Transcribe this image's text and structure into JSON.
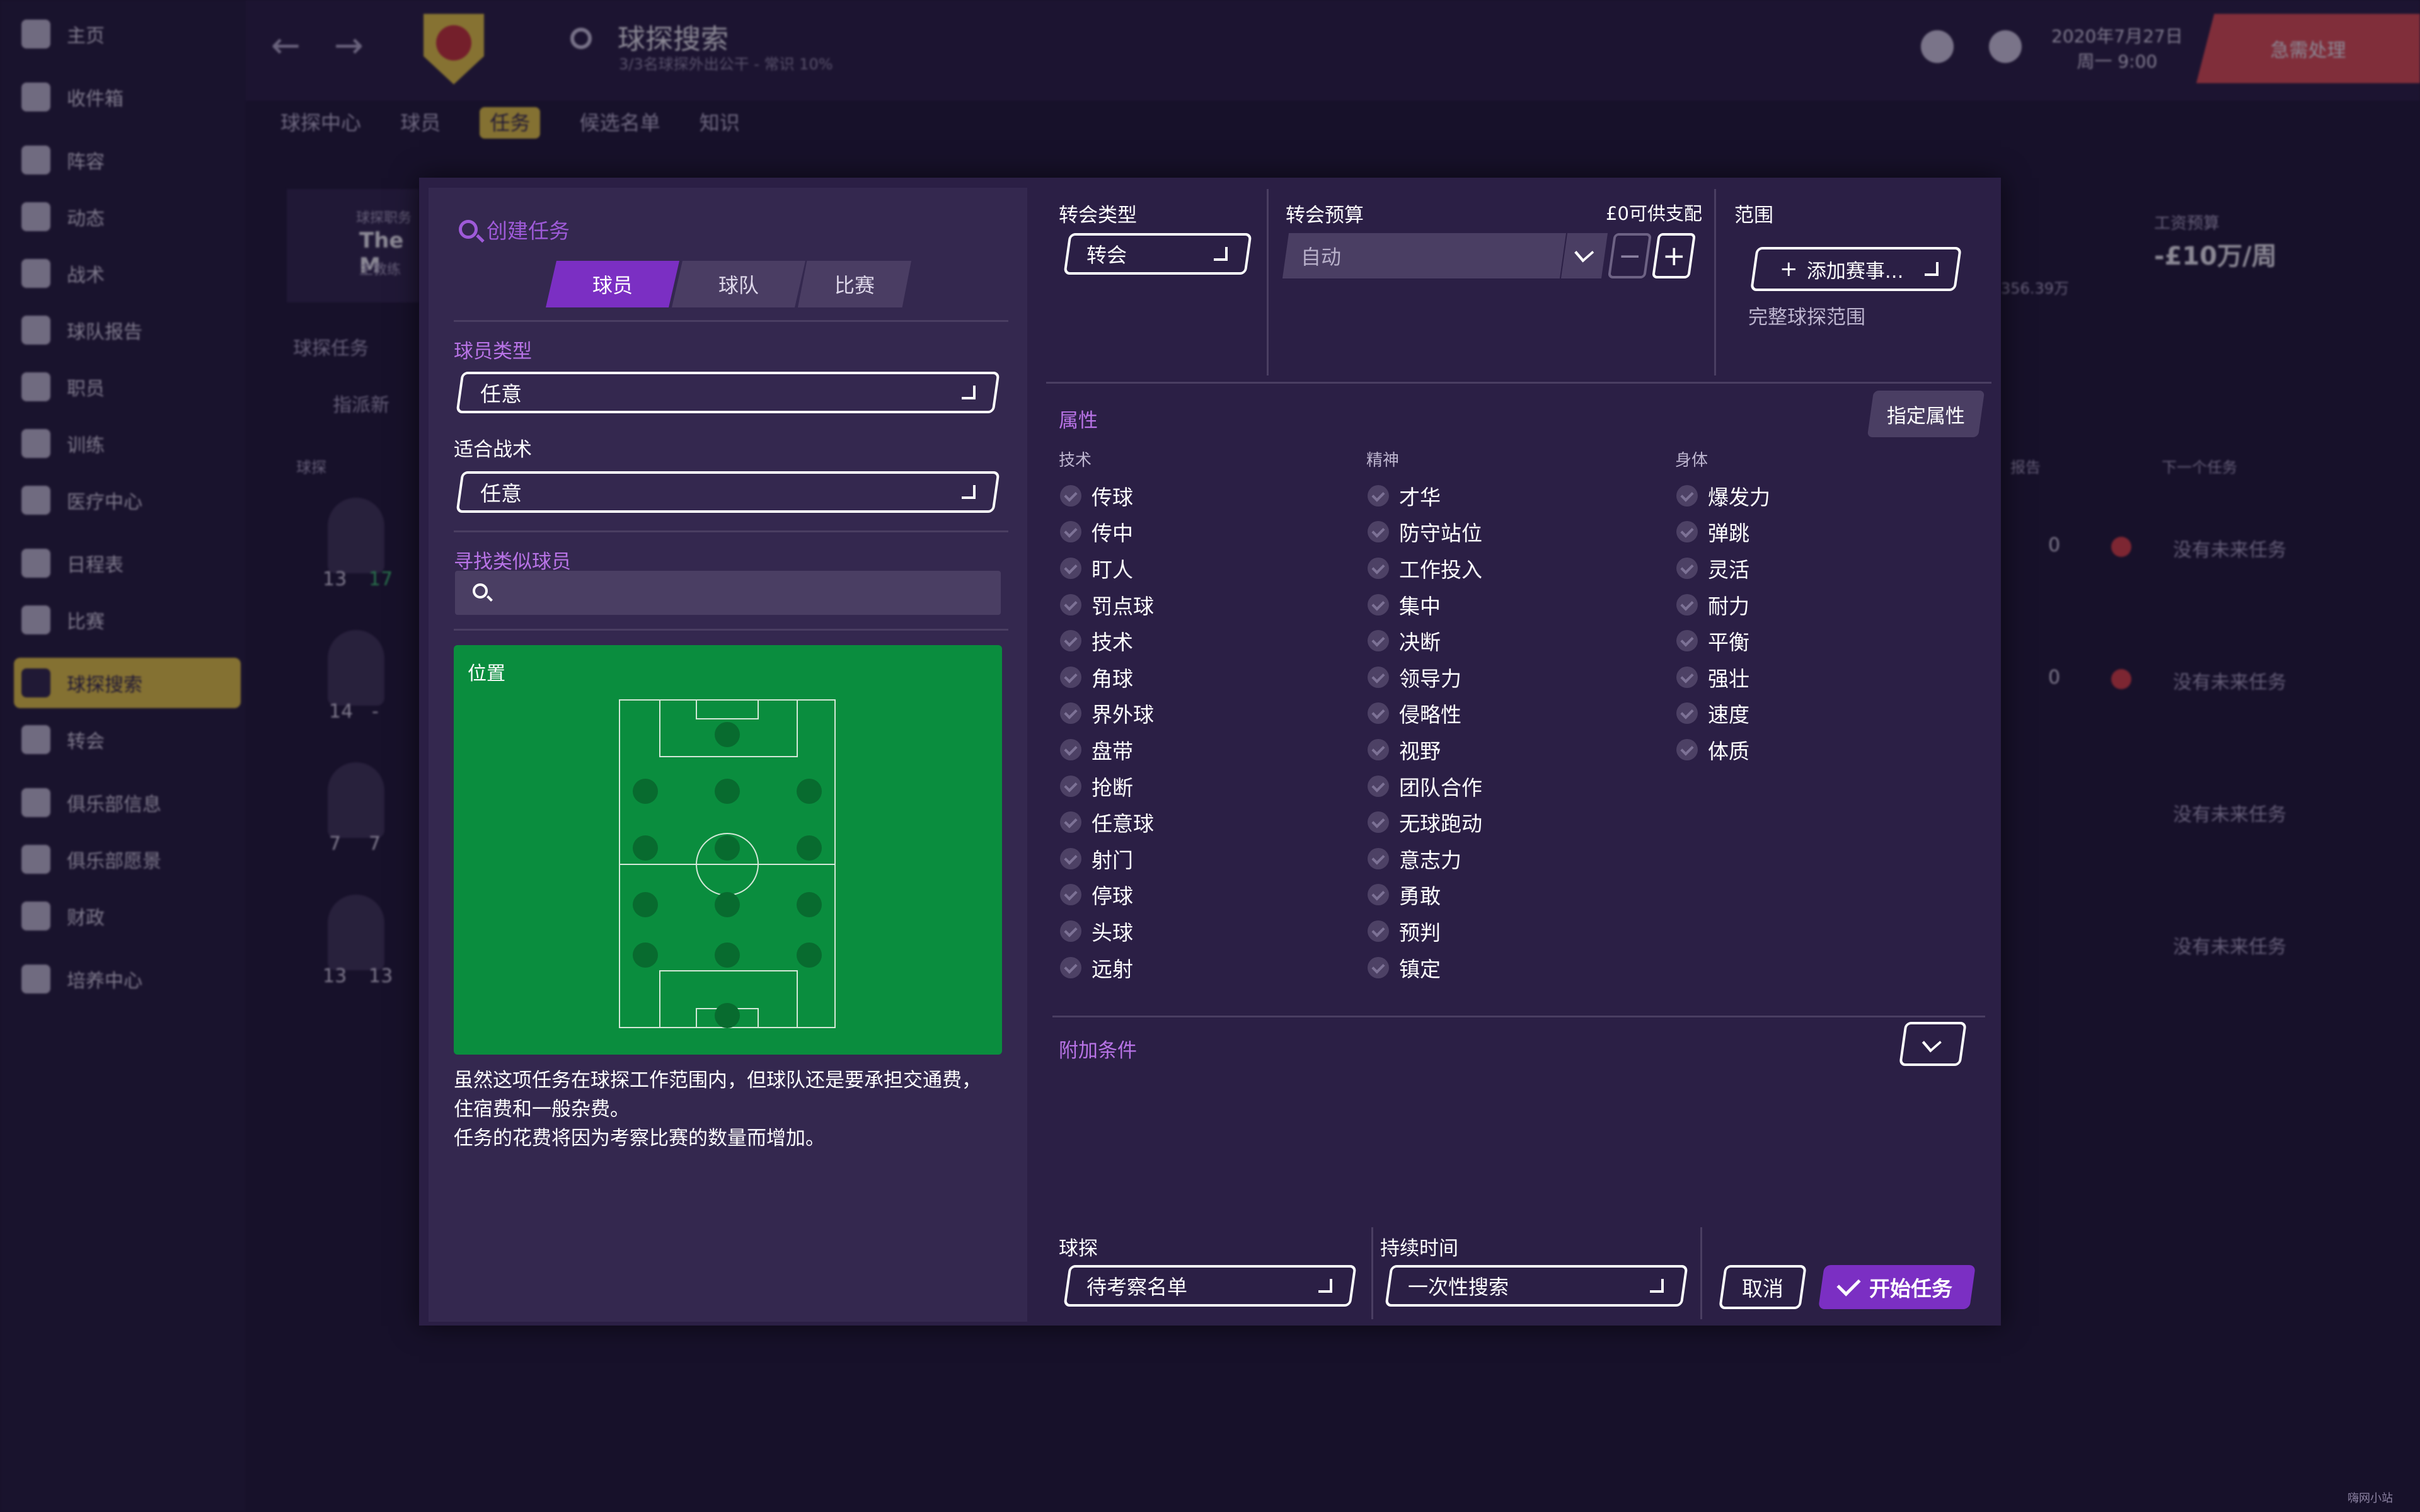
{
  "sidebar": {
    "items": [
      {
        "label": "主页"
      },
      {
        "label": "收件箱"
      },
      {
        "label": "阵容"
      },
      {
        "label": "动态"
      },
      {
        "label": "战术"
      },
      {
        "label": "球队报告"
      },
      {
        "label": "职员"
      },
      {
        "label": "训练"
      },
      {
        "label": "医疗中心"
      },
      {
        "label": "日程表"
      },
      {
        "label": "比赛"
      },
      {
        "label": "球探搜索"
      },
      {
        "label": "转会"
      },
      {
        "label": "俱乐部信息"
      },
      {
        "label": "俱乐部愿景"
      },
      {
        "label": "财政"
      },
      {
        "label": "培养中心"
      }
    ],
    "active_index": 11
  },
  "header": {
    "title": "球探搜索",
    "subtitle": "3/3名球探外出公干 - 常识 10%",
    "tabs": [
      "球探中心",
      "球员",
      "任务",
      "候选名单",
      "知识"
    ],
    "active_tab": 2,
    "date": "2020年7月27日",
    "day_time": "周一 9:00",
    "urgent": "急需处理"
  },
  "background": {
    "card_label": "球探职务",
    "card_name": "The M",
    "card_role": "主教练",
    "section_title": "球探任务",
    "add_button": "指派新",
    "col_player": "球探",
    "col_report": "报告",
    "col_next": "下一个任务",
    "wage_label": "工资预算",
    "wage_value": "-£10万/周",
    "wage_sub": "356.39万",
    "rows": [
      {
        "a": "13",
        "b": "17",
        "reports": "0",
        "next": "没有未来任务"
      },
      {
        "a": "14",
        "b": "-",
        "reports": "0",
        "next": "没有未来任务"
      },
      {
        "a": "7",
        "b": "7",
        "reports": "",
        "next": "没有未来任务"
      },
      {
        "a": "13",
        "b": "13",
        "reports": "",
        "next": "没有未来任务"
      }
    ]
  },
  "modal": {
    "create_task": "创建任务",
    "segments": [
      "球员",
      "球队",
      "比赛"
    ],
    "active_segment": 0,
    "player_type_label": "球员类型",
    "player_type_value": "任意",
    "tactic_label": "适合战术",
    "tactic_value": "任意",
    "similar_label": "寻找类似球员",
    "position_label": "位置",
    "note_lines": [
      "虽然这项任务在球探工作范围内，但球队还是要承担交通费，",
      "住宿费和一般杂费。",
      "任务的花费将因为考察比赛的数量而增加。"
    ],
    "transfer_type_label": "转会类型",
    "transfer_type_value": "转会",
    "budget_label": "转会预算",
    "budget_available": "£0可供支配",
    "budget_value": "自动",
    "budget_minus": "−",
    "budget_plus": "+",
    "range_label": "范围",
    "add_comp": "添加赛事...",
    "full_range": "完整球探范围",
    "attributes_label": "属性",
    "specify_attributes": "指定属性",
    "tech_label": "技术",
    "mental_label": "精神",
    "physical_label": "身体",
    "technical": [
      "传球",
      "传中",
      "盯人",
      "罚点球",
      "技术",
      "角球",
      "界外球",
      "盘带",
      "抢断",
      "任意球",
      "射门",
      "停球",
      "头球",
      "远射"
    ],
    "mental": [
      "才华",
      "防守站位",
      "工作投入",
      "集中",
      "决断",
      "领导力",
      "侵略性",
      "视野",
      "团队合作",
      "无球跑动",
      "意志力",
      "勇敢",
      "预判",
      "镇定"
    ],
    "physical": [
      "爆发力",
      "弹跳",
      "灵活",
      "耐力",
      "平衡",
      "强壮",
      "速度",
      "体质"
    ],
    "extra_label": "附加条件",
    "scout_label": "球探",
    "scout_value": "待考察名单",
    "duration_label": "持续时间",
    "duration_value": "一次性搜索",
    "cancel": "取消",
    "start": "开始任务"
  },
  "watermark": "嗨网小站",
  "colors": {
    "accent_purple": "#7b2fc3",
    "label_purple": "#b873e6",
    "pitch_green": "#0a8d3e",
    "highlight_yellow": "#f1d03a",
    "urgent_red": "#e84b4b"
  }
}
